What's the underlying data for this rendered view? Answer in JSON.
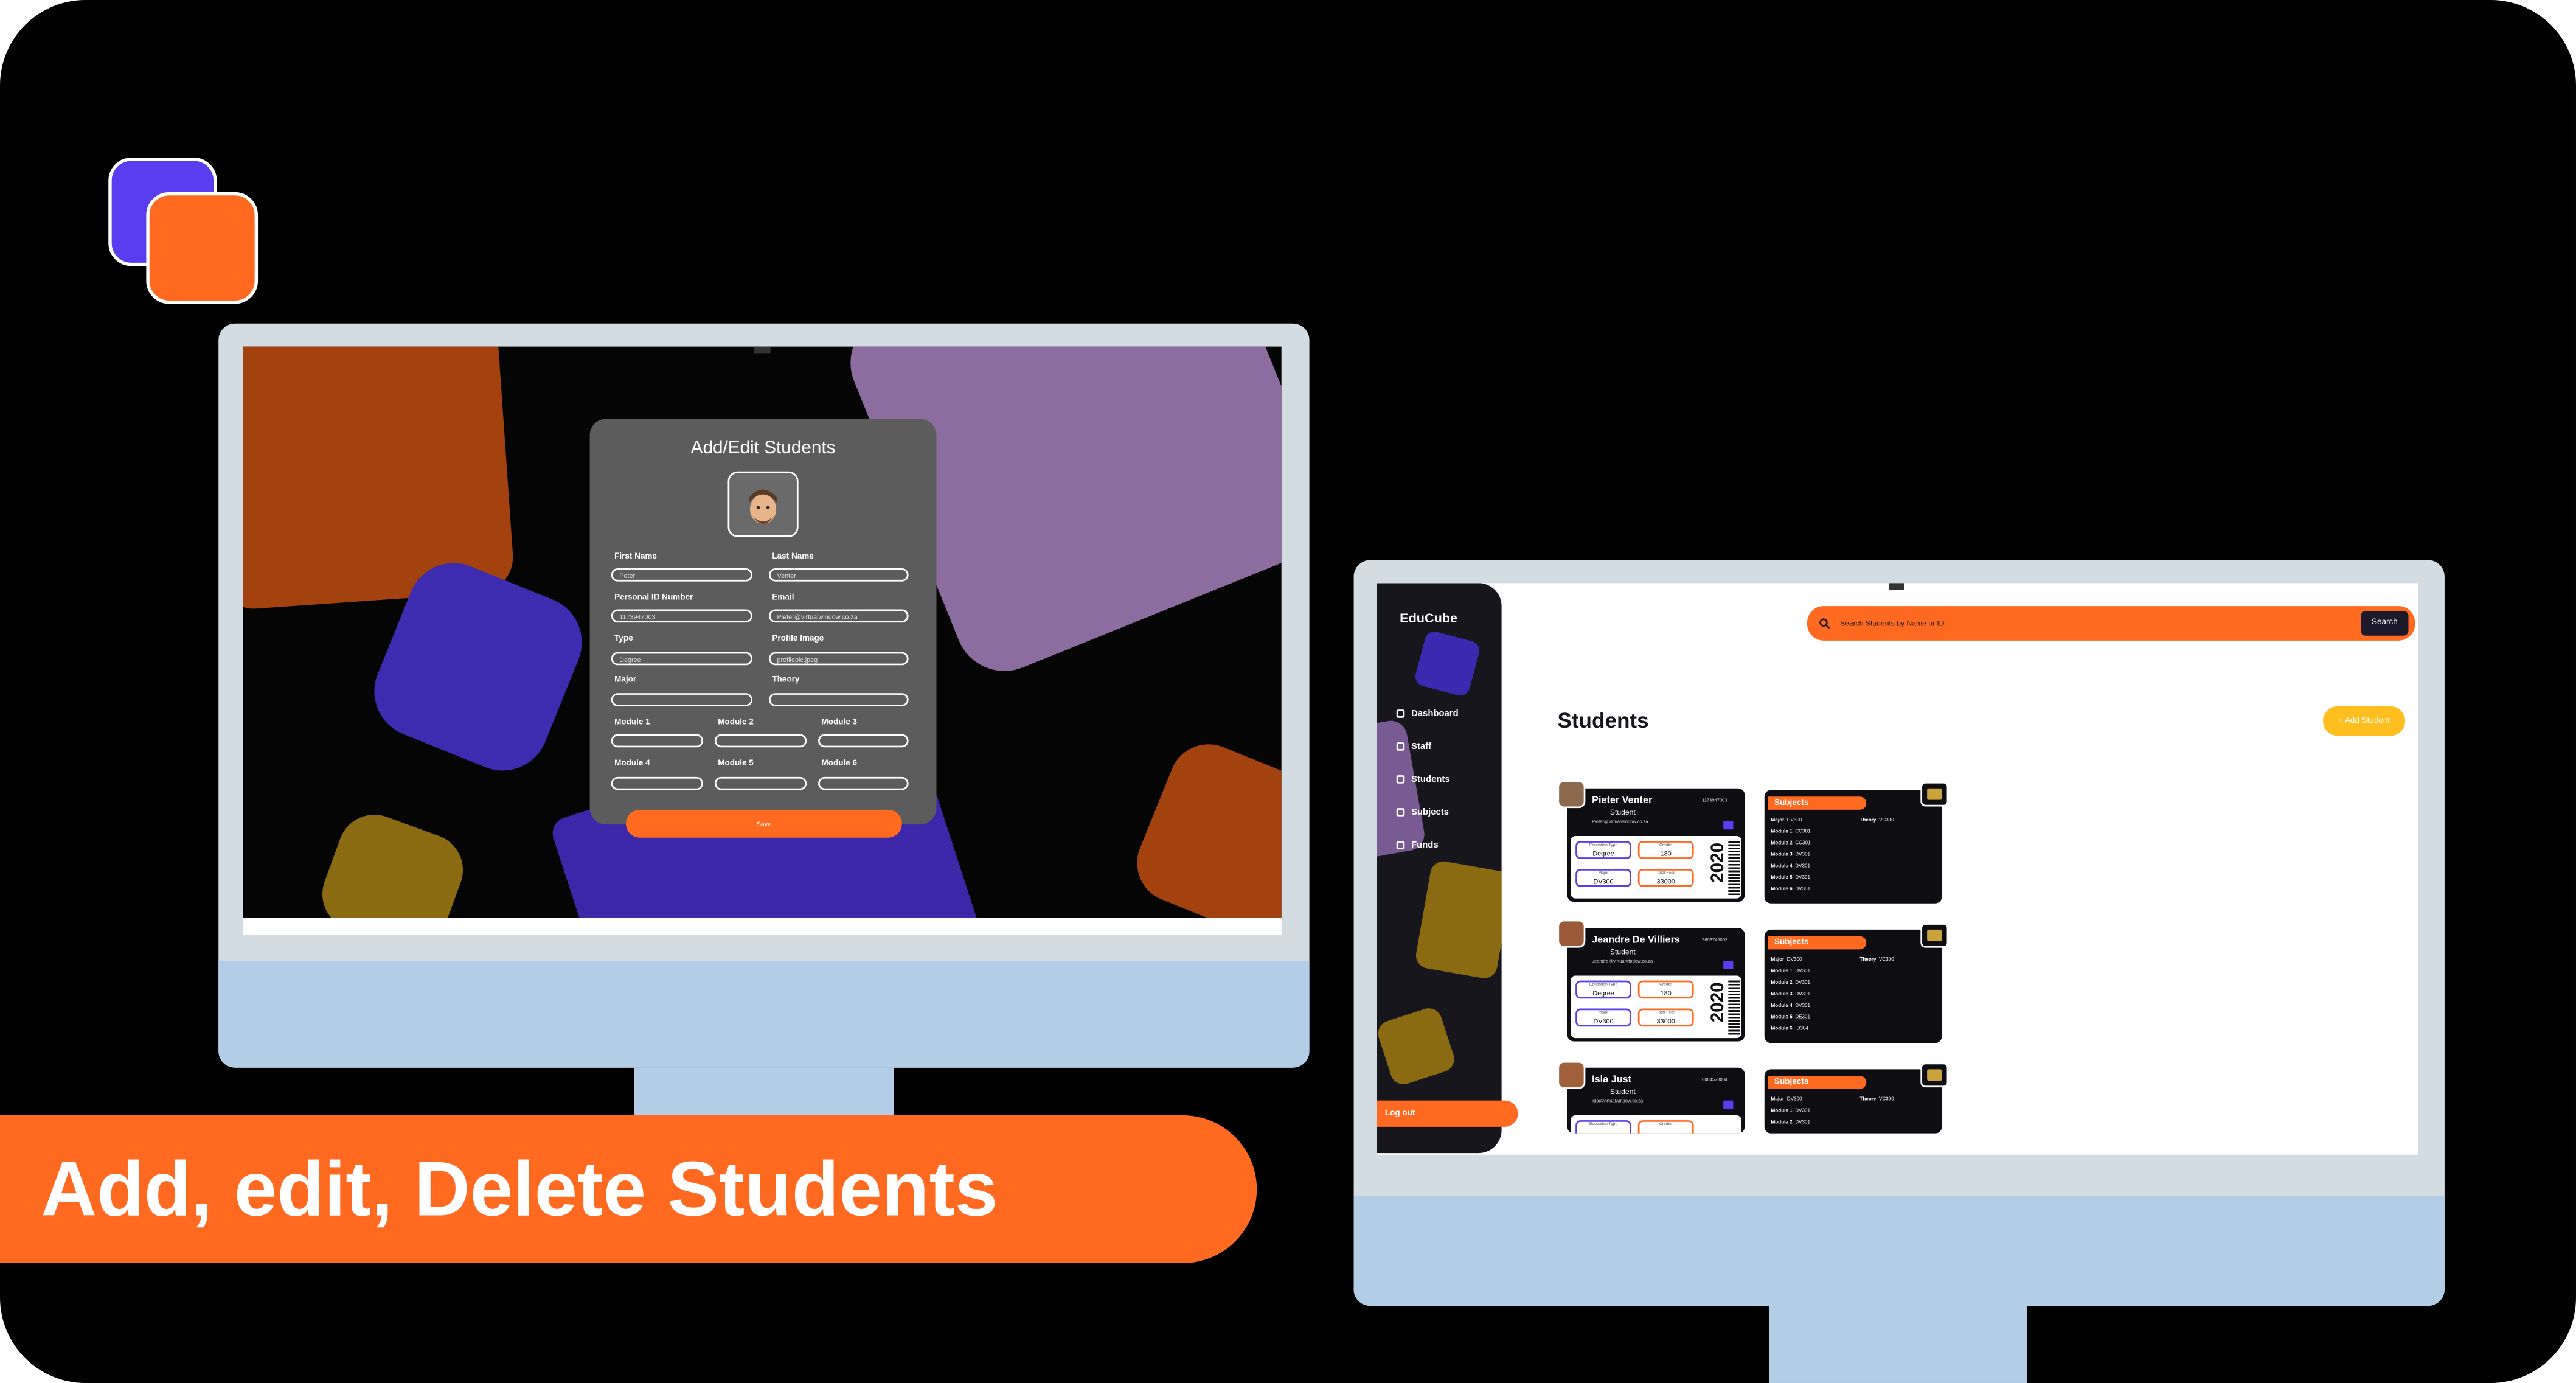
{
  "banner": {
    "text": "Add, edit, Delete Students"
  },
  "colors": {
    "accent": "#ff6a20",
    "purple": "#5b3df0",
    "dark": "#16161c",
    "yellow": "#ffbf1f"
  },
  "form": {
    "title": "Add/Edit Students",
    "avatar_icon": "avatar-icon",
    "fields": {
      "first_name": {
        "label": "First Name",
        "value": "Peter"
      },
      "last_name": {
        "label": "Last Name",
        "value": "Venter"
      },
      "personal_id": {
        "label": "Personal ID Number",
        "value": "1173947003"
      },
      "email": {
        "label": "Email",
        "value": "Pieter@virtualwindow.co.za"
      },
      "type": {
        "label": "Type",
        "value": "Degree"
      },
      "profile_image": {
        "label": "Profile Image",
        "value": "profilepic.jpeg"
      },
      "major": {
        "label": "Major",
        "value": ""
      },
      "theory": {
        "label": "Theory",
        "value": ""
      },
      "module1": {
        "label": "Module 1",
        "value": ""
      },
      "module2": {
        "label": "Module 2",
        "value": ""
      },
      "module3": {
        "label": "Module 3",
        "value": ""
      },
      "module4": {
        "label": "Module 4",
        "value": ""
      },
      "module5": {
        "label": "Module 5",
        "value": ""
      },
      "module6": {
        "label": "Module 6",
        "value": ""
      }
    },
    "save_label": "Save"
  },
  "app": {
    "brand": "EduCube",
    "nav": [
      {
        "label": "Dashboard",
        "icon": "grid-icon"
      },
      {
        "label": "Staff",
        "icon": "person-icon"
      },
      {
        "label": "Students",
        "icon": "students-icon"
      },
      {
        "label": "Subjects",
        "icon": "book-icon"
      },
      {
        "label": "Funds",
        "icon": "money-icon"
      }
    ],
    "logout_label": "Log out",
    "search": {
      "placeholder": "Search Students by Name or ID",
      "button": "Search"
    },
    "page_title": "Students",
    "add_button": "+ Add Student",
    "students": [
      {
        "name": "Pieter Venter",
        "role": "Student",
        "email": "Pieter@virtualwindow.co.za",
        "id": "1173947003",
        "edu_type_label": "Education Type",
        "edu_type": "Degree",
        "credits_label": "Credits",
        "credits": "180",
        "major_label": "Major",
        "major": "DV300",
        "total_fees_label": "Total Fees",
        "total_fees": "33000",
        "year": "2020"
      },
      {
        "name": "Jeandre De Villiers",
        "role": "Student",
        "email": "Jeandre@virtualwindow.co.za",
        "id": "9803745003",
        "edu_type_label": "Education Type",
        "edu_type": "Degree",
        "credits_label": "Credits",
        "credits": "180",
        "major_label": "Major",
        "major": "DV300",
        "total_fees_label": "Total Fees",
        "total_fees": "33000",
        "year": "2020"
      },
      {
        "name": "Isla Just",
        "role": "Student",
        "email": "isla@virtualwindow.co.za",
        "id": "0084578004",
        "edu_type_label": "Education Type",
        "credits_label": "Credits"
      }
    ],
    "subjects": [
      {
        "tag": "Subjects",
        "major_label": "Major",
        "major": "DV300",
        "theory_label": "Theory",
        "theory": "VC300",
        "modules": [
          {
            "label": "Module 1",
            "value": "CC301"
          },
          {
            "label": "Module 2",
            "value": "CC301"
          },
          {
            "label": "Module 3",
            "value": "DV301"
          },
          {
            "label": "Module 4",
            "value": "DV301"
          },
          {
            "label": "Module 5",
            "value": "DV301"
          },
          {
            "label": "Module 6",
            "value": "DV301"
          }
        ]
      },
      {
        "tag": "Subjects",
        "major_label": "Major",
        "major": "DV300",
        "theory_label": "Theory",
        "theory": "VC300",
        "modules": [
          {
            "label": "Module 1",
            "value": "DV301"
          },
          {
            "label": "Module 2",
            "value": "DV301"
          },
          {
            "label": "Module 3",
            "value": "DV301"
          },
          {
            "label": "Module 4",
            "value": "DV301"
          },
          {
            "label": "Module 5",
            "value": "DE301"
          },
          {
            "label": "Module 6",
            "value": "ID304"
          }
        ]
      },
      {
        "tag": "Subjects",
        "major_label": "Major",
        "major": "DV300",
        "theory_label": "Theory",
        "theory": "VC300",
        "modules": [
          {
            "label": "Module 1",
            "value": "DV301"
          },
          {
            "label": "Module 2",
            "value": "DV301"
          }
        ]
      }
    ]
  }
}
